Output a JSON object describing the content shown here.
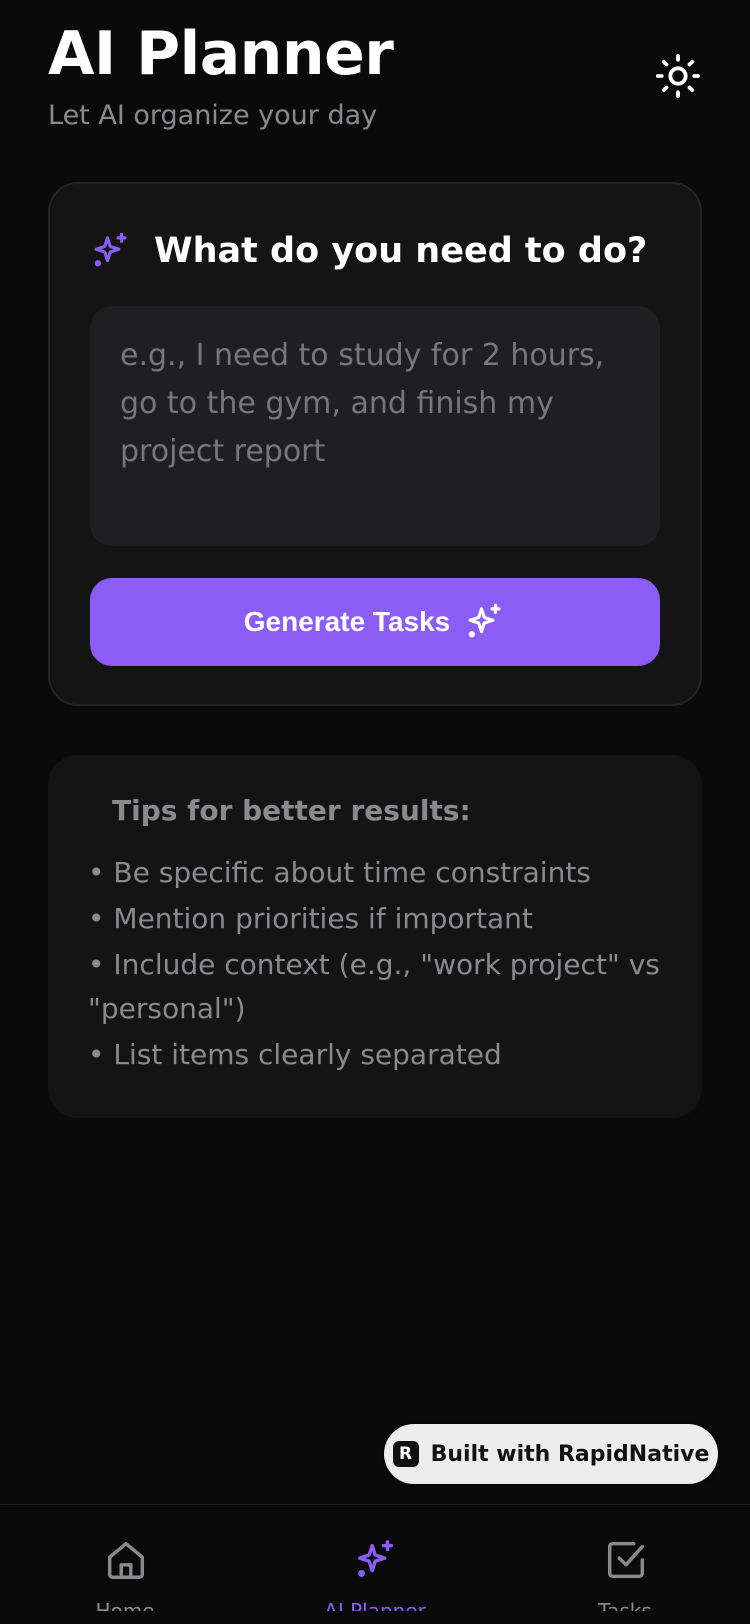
{
  "header": {
    "title": "AI Planner",
    "subtitle": "Let AI organize your day",
    "theme_icon": "sun-icon"
  },
  "planner": {
    "heading": "What do you need to do?",
    "heading_icon": "sparkles-icon",
    "input_value": "",
    "input_placeholder": "e.g., I need to study for 2 hours, go to the gym, and finish my project report",
    "generate_label": "Generate Tasks"
  },
  "tips": {
    "title": "Tips for better results:",
    "items": [
      "• Be specific about time constraints",
      "• Mention priorities if important",
      "• Include context (e.g., \"work project\" vs \"personal\")",
      "• List items clearly separated"
    ]
  },
  "badge": {
    "label": "Built with RapidNative"
  },
  "tabbar": {
    "tabs": [
      {
        "label": "Home",
        "icon": "home-icon",
        "active": false
      },
      {
        "label": "AI Planner",
        "icon": "sparkles-icon",
        "active": true
      },
      {
        "label": "Tasks",
        "icon": "checkbox-icon",
        "active": false
      }
    ]
  },
  "colors": {
    "background": "#0a0a0b",
    "card": "#141415",
    "input": "#1f1f21",
    "accent": "#8b5cf6",
    "muted_text": "#8a8a8e"
  }
}
